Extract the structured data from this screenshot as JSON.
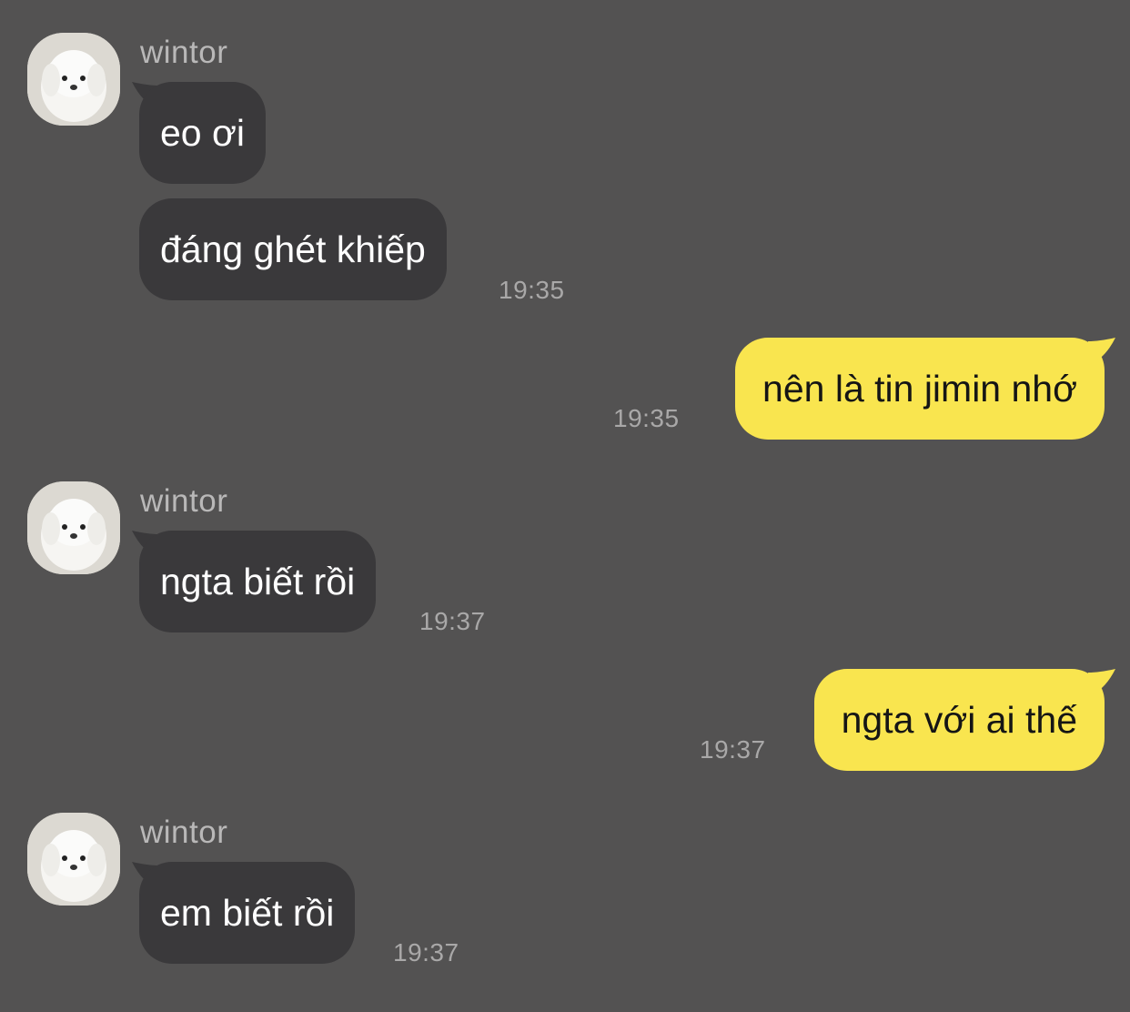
{
  "chat": {
    "groups": [
      {
        "sender": "wintor",
        "messages": [
          {
            "text": "eo ơi"
          },
          {
            "text": "đáng ghét khiếp",
            "time": "19:35"
          }
        ]
      },
      {
        "outgoing": {
          "text": "nên là tin jimin nhớ",
          "time": "19:35"
        }
      },
      {
        "sender": "wintor",
        "messages": [
          {
            "text": "ngta biết rồi",
            "time": "19:37"
          }
        ]
      },
      {
        "outgoing": {
          "text": "ngta với ai thế",
          "time": "19:37"
        }
      },
      {
        "sender": "wintor",
        "messages": [
          {
            "text": "em biết rồi",
            "time": "19:37"
          }
        ]
      }
    ]
  },
  "colors": {
    "background": "#535252",
    "incoming_bubble": "#3a393b",
    "outgoing_bubble": "#f9e54f"
  },
  "icons": {
    "avatar": "white-puppy-avatar"
  }
}
